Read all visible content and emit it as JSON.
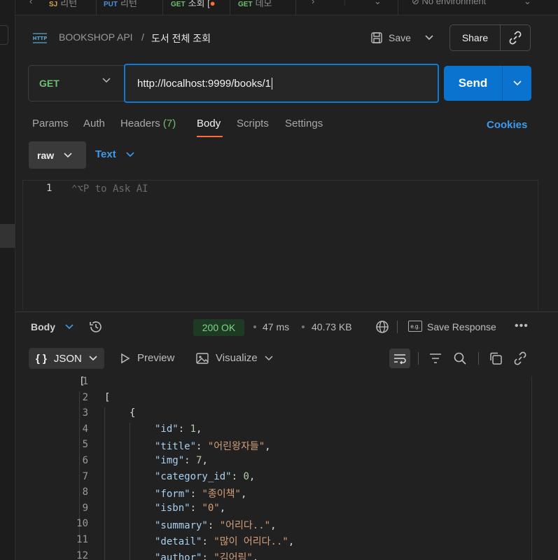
{
  "top_tabs": [
    {
      "method": "SJ",
      "name": "리턴"
    },
    {
      "method": "PUT",
      "name": "리턴"
    },
    {
      "method": "GET",
      "name": "조회 [",
      "active": true
    },
    {
      "method": "GET",
      "name": "데모"
    }
  ],
  "environment": "No environment",
  "breadcrumb": {
    "collection": "BOOKSHOP API",
    "separator": "/",
    "request": "도서 전체 조회"
  },
  "toolbar": {
    "save_label": "Save",
    "share_label": "Share"
  },
  "request": {
    "method": "GET",
    "url": "http://localhost:9999/books/1",
    "send_label": "Send"
  },
  "request_tabs": [
    {
      "label": "Params"
    },
    {
      "label": "Auth"
    },
    {
      "label": "Headers",
      "count": "(7)"
    },
    {
      "label": "Body",
      "active": true
    },
    {
      "label": "Scripts"
    },
    {
      "label": "Settings"
    }
  ],
  "cookies_label": "Cookies",
  "body_options": {
    "mode": "raw",
    "type": "Text"
  },
  "editor": {
    "line": "1",
    "placeholder": "⌃⌥P to Ask AI"
  },
  "response": {
    "section_label": "Body",
    "status": "200 OK",
    "time": "47 ms",
    "size": "40.73 KB",
    "save_response": "Save Response",
    "format": "JSON",
    "preview_label": "Preview",
    "visualize_label": "Visualize"
  },
  "colors": {
    "accent_orange": "#ff6c37",
    "send_blue": "#0a73cf",
    "method_green": "#6fbf73",
    "link_blue": "#3d9be9"
  },
  "code_lines": [
    {
      "n": "1",
      "indent": 0,
      "text": "["
    },
    {
      "n": "2",
      "indent": 1,
      "text": "["
    },
    {
      "n": "3",
      "indent": 2,
      "text": "{"
    },
    {
      "n": "4",
      "indent": 3,
      "key": "\"id\"",
      "value": "1",
      "vtype": "n",
      "comma": ","
    },
    {
      "n": "5",
      "indent": 3,
      "key": "\"title\"",
      "value": "\"어린왕자들\"",
      "vtype": "s",
      "comma": ","
    },
    {
      "n": "6",
      "indent": 3,
      "key": "\"img\"",
      "value": "7",
      "vtype": "n",
      "comma": ","
    },
    {
      "n": "7",
      "indent": 3,
      "key": "\"category_id\"",
      "value": "0",
      "vtype": "n",
      "comma": ","
    },
    {
      "n": "8",
      "indent": 3,
      "key": "\"form\"",
      "value": "\"종이책\"",
      "vtype": "s",
      "comma": ","
    },
    {
      "n": "9",
      "indent": 3,
      "key": "\"isbn\"",
      "value": "\"0\"",
      "vtype": "s",
      "comma": ","
    },
    {
      "n": "10",
      "indent": 3,
      "key": "\"summary\"",
      "value": "\"어리다..\"",
      "vtype": "s",
      "comma": ","
    },
    {
      "n": "11",
      "indent": 3,
      "key": "\"detail\"",
      "value": "\"많이 어리다..\"",
      "vtype": "s",
      "comma": ","
    },
    {
      "n": "12",
      "indent": 3,
      "key": "\"author\"",
      "value": "\"김어림\"",
      "vtype": "s",
      "comma": ","
    }
  ]
}
